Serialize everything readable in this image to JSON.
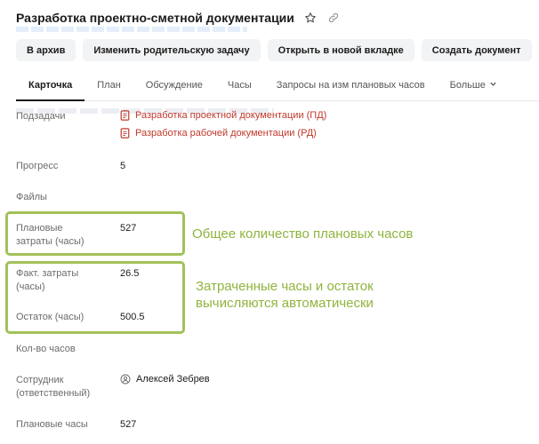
{
  "header": {
    "title": "Разработка проектно-сметной документации"
  },
  "toolbar": {
    "archive": "В архив",
    "change_parent": "Изменить родительскую задачу",
    "open_new_tab": "Открыть в новой вкладке",
    "create_doc": "Создать документ",
    "more": "•••"
  },
  "tabs": [
    {
      "label": "Карточка"
    },
    {
      "label": "План"
    },
    {
      "label": "Обсуждение"
    },
    {
      "label": "Часы"
    },
    {
      "label": "Запросы на изм плановых часов"
    },
    {
      "label": "Больше"
    }
  ],
  "fields": {
    "subtasks": {
      "label": "Подзадачи",
      "items": [
        "Разработка проектной документации (ПД)",
        "Разработка рабочей документации (РД)"
      ]
    },
    "progress": {
      "label": "Прогресс",
      "value": "5"
    },
    "files": {
      "label": "Файлы"
    },
    "planned_costs": {
      "label_1": "Плановые",
      "label_2": "затраты (часы)",
      "value": "527"
    },
    "actual_costs": {
      "label_1": "Факт. затраты",
      "label_2": "(часы)",
      "value": "26.5"
    },
    "remaining": {
      "label": "Остаток (часы)",
      "value": "500.5"
    },
    "hours_count": {
      "label": "Кол-во часов"
    },
    "employee": {
      "label_1": "Сотрудник",
      "label_2": "(ответственный)",
      "value": "Алексей Зебрев"
    },
    "planned_hours": {
      "label": "Плановые часы",
      "value": "527"
    }
  },
  "annotations": {
    "planned_note": "Общее количество плановых часов",
    "auto_note_1": "Затраченные часы и остаток",
    "auto_note_2": "вычисляются автоматически"
  },
  "colors": {
    "highlight": "#a2c15a",
    "annotation_text": "#8fb43d",
    "subtask_link": "#c0392b"
  }
}
